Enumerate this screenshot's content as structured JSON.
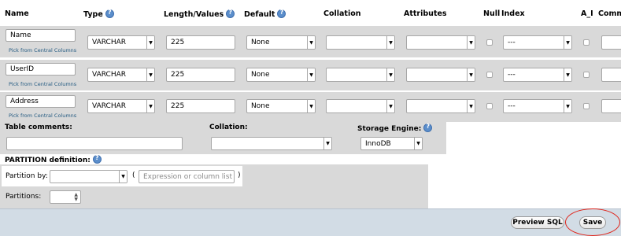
{
  "headers": {
    "name": "Name",
    "type": "Type",
    "length": "Length/Values",
    "default": "Default",
    "collation": "Collation",
    "attributes": "Attributes",
    "null": "Null",
    "index": "Index",
    "ai": "A_I",
    "comments": "Comme"
  },
  "columns": [
    {
      "name": "Name",
      "pick_link": "Pick from Central Columns",
      "type": "VARCHAR",
      "length": "225",
      "default": "None",
      "collation": "",
      "attributes": "",
      "null": false,
      "index": "---",
      "ai": false,
      "comment": ""
    },
    {
      "name": "UserID",
      "pick_link": "Pick from Central Columns",
      "type": "VARCHAR",
      "length": "225",
      "default": "None",
      "collation": "",
      "attributes": "",
      "null": false,
      "index": "---",
      "ai": false,
      "comment": ""
    },
    {
      "name": "Address",
      "pick_link": "Pick from Central Columns",
      "type": "VARCHAR",
      "length": "225",
      "default": "None",
      "collation": "",
      "attributes": "",
      "null": false,
      "index": "---",
      "ai": false,
      "comment": ""
    }
  ],
  "table_options": {
    "comments_label": "Table comments:",
    "comments_value": "",
    "collation_label": "Collation:",
    "collation_value": "",
    "engine_label": "Storage Engine:",
    "engine_value": "InnoDB"
  },
  "partition": {
    "title": "PARTITION definition:",
    "by_label": "Partition by:",
    "by_value": "",
    "open_paren": "(",
    "expr_placeholder": "Expression or column list",
    "close_paren": ")",
    "partitions_label": "Partitions:",
    "partitions_value": ""
  },
  "footer": {
    "preview_label": "Preview SQL",
    "save_label": "Save"
  },
  "colors": {
    "row_bg": "#d9d9d9",
    "footer_bg": "#d2dce5",
    "highlight": "#e0251b",
    "link": "#235a81"
  }
}
